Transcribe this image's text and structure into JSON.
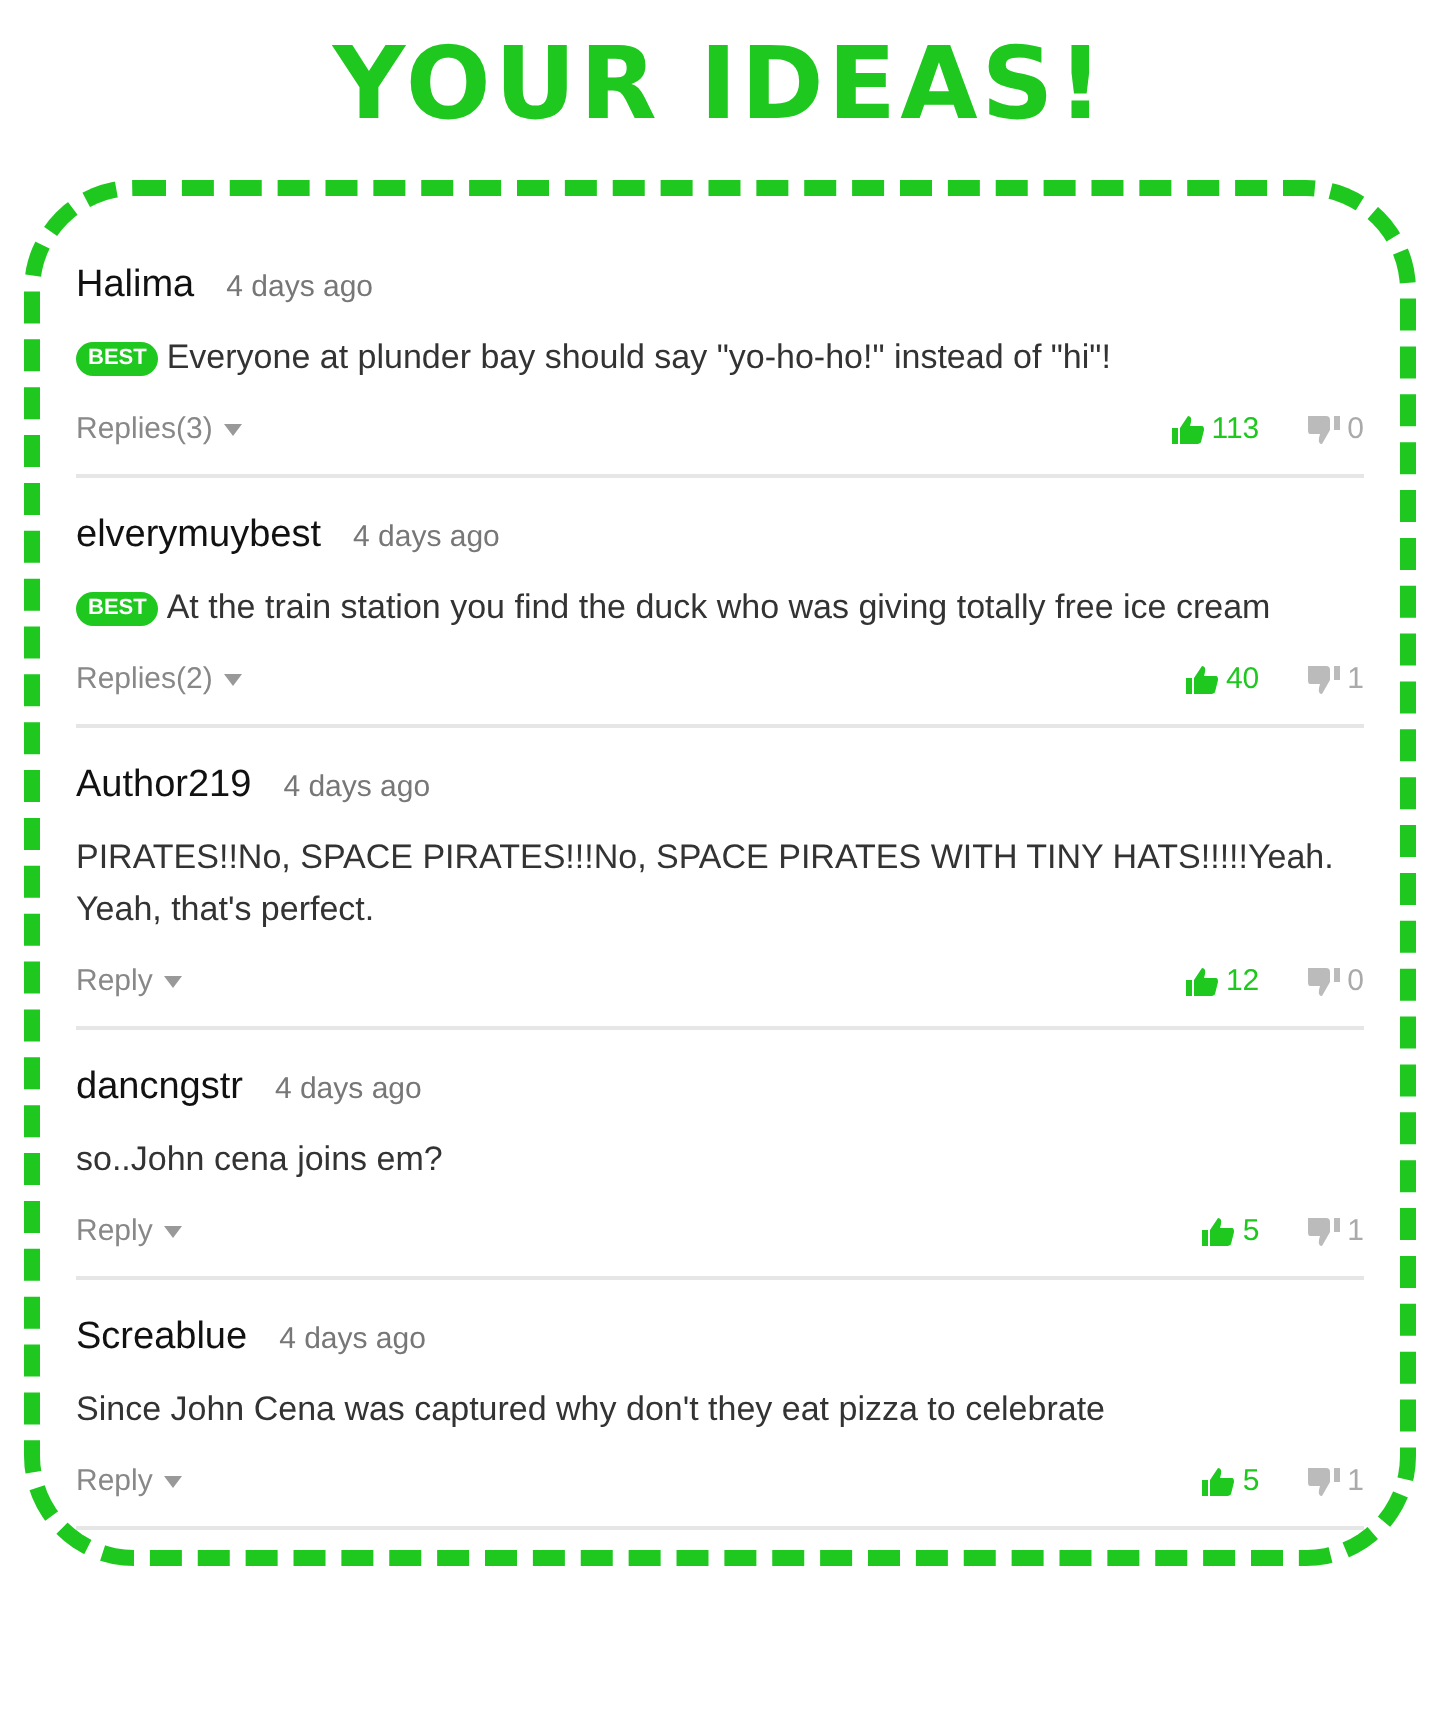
{
  "title": "YOUR IDEAS!",
  "comments": [
    {
      "author": "Halima",
      "time": "4 days ago",
      "badge": "BEST",
      "text": "Everyone at plunder bay should say \"yo-ho-ho!\" instead of \"hi\"!",
      "replies": "Replies(3)",
      "up": "113",
      "down": "0"
    },
    {
      "author": "elverymuybest",
      "time": "4 days ago",
      "badge": "BEST",
      "text": "At the train station you find the duck who was giving totally free ice cream",
      "replies": "Replies(2)",
      "up": "40",
      "down": "1"
    },
    {
      "author": "Author219",
      "time": "4 days ago",
      "text": "PIRATES!!No, SPACE PIRATES!!!No, SPACE PIRATES WITH TINY HATS!!!!!Yeah. Yeah, that's perfect.",
      "replies": "Reply",
      "up": "12",
      "down": "0"
    },
    {
      "author": "dancngstr",
      "time": "4 days ago",
      "text": "so..John cena joins em?",
      "replies": "Reply",
      "up": "5",
      "down": "1"
    },
    {
      "author": "Screablue",
      "time": "4 days ago",
      "text": "Since John Cena was captured why don't they eat pizza to celebrate",
      "replies": "Reply",
      "up": "5",
      "down": "1"
    }
  ]
}
